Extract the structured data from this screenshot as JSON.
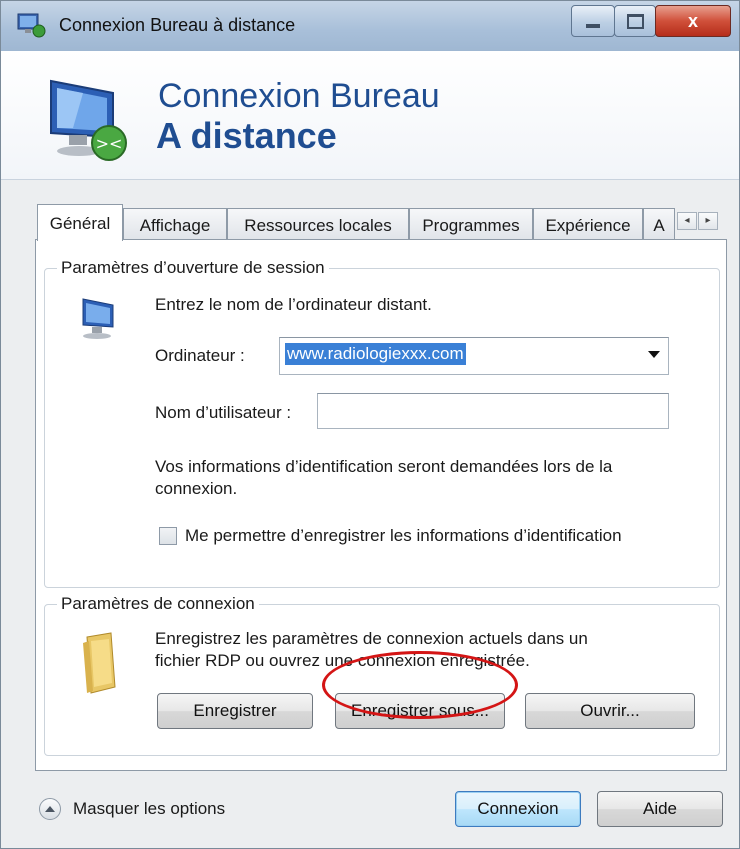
{
  "window": {
    "title": "Connexion Bureau à distance",
    "close_label": "x"
  },
  "banner": {
    "line1": "Connexion Bureau",
    "line2": "A distance"
  },
  "tabs": [
    {
      "label": "Général",
      "active": true
    },
    {
      "label": "Affichage",
      "active": false
    },
    {
      "label": "Ressources locales",
      "active": false
    },
    {
      "label": "Programmes",
      "active": false
    },
    {
      "label": "Expérience",
      "active": false
    },
    {
      "label": "A",
      "active": false
    }
  ],
  "tab_scroll": {
    "left": "◂",
    "right": "▸"
  },
  "session": {
    "group_title": "Paramètres d’ouverture de session",
    "intro": "Entrez le nom de l’ordinateur distant.",
    "computer_label": "Ordinateur :",
    "computer_value": "www.radiologiexxx.com",
    "username_label": "Nom d’utilisateur :",
    "username_value": "",
    "info_text_1": "Vos informations d’identification seront demandées lors de la",
    "info_text_2": "connexion.",
    "save_credentials_label": "Me permettre d’enregistrer les informations d’identification",
    "save_credentials_checked": false
  },
  "connection": {
    "group_title": "Paramètres de connexion",
    "desc_1": "Enregistrez les paramètres de connexion actuels dans un",
    "desc_2": "fichier RDP ou ouvrez une connexion enregistrée.",
    "save_button": "Enregistrer",
    "save_as_button": "Enregistrer sous...",
    "open_button": "Ouvrir..."
  },
  "footer": {
    "hide_options": "Masquer les options",
    "connect_button": "Connexion",
    "help_button": "Aide"
  },
  "colors": {
    "banner_text": "#1f4d91",
    "selection": "#3a80d6",
    "annotation": "#d41515"
  }
}
